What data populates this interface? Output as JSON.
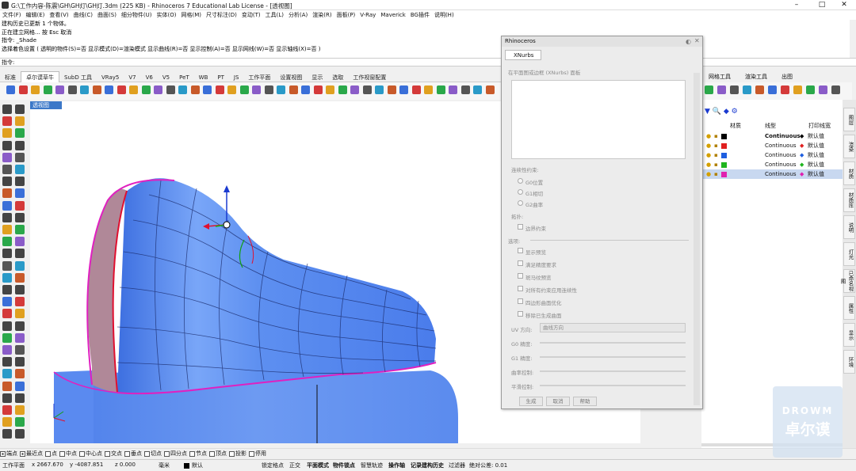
{
  "title_bar": {
    "text": "G:\\工作内容-陈震\\GH\\GH灯\\GH灯.3dm (225 KB) - Rhinoceros 7 Educational Lab License - [透视图]"
  },
  "menu": [
    "文件(F)",
    "编辑(E)",
    "查看(V)",
    "曲线(C)",
    "曲面(S)",
    "细分物件(U)",
    "实体(O)",
    "网格(M)",
    "尺寸标注(D)",
    "变动(T)",
    "工具(L)",
    "分析(A)",
    "渲染(R)",
    "面板(P)",
    "V-Ray",
    "Maverick",
    "BG插件",
    "说明(H)"
  ],
  "command_history": [
    "建构历史已更新 1 个物体。",
    "正在建立网格... 按 Esc 取消",
    "指令: _Shade",
    "选择着色设置 ( 透明的物件(S)=否  显示模式(D)=渲染模式  显示曲线(R)=否  显示控制(A)=否  显示网线(W)=否  显示轴线(X)=否 )"
  ],
  "command_prompt": "指令:",
  "toolbar_tabs": [
    "标准",
    "卓尔谟草牛",
    "SubD 工具",
    "VRay5",
    "V7",
    "V6",
    "V5",
    "PeT",
    "WB",
    "PT",
    "JS",
    "工作平面",
    "设置视图",
    "显示",
    "选取",
    "工作视窗配置"
  ],
  "toolbar_tabs_active": 1,
  "toolbar_tabs_right": [
    "网格工具",
    "渲染工具",
    "出图"
  ],
  "viewport": {
    "label": "透视图"
  },
  "xnurbs_panel": {
    "title": "Rhinoceros",
    "tab": "XNurbs",
    "section1": "在平面图或边框 (XNurbs) 面板",
    "section2": "连续性约束:",
    "radio_options": [
      "G0位置",
      "G1相切",
      "G2曲率"
    ],
    "section3": "拓扑:",
    "boundary_opt": "边界约束",
    "section4": "选项:",
    "checkbox_options": [
      "显示预览",
      "满足精度要求",
      "斑马纹预览",
      "对所有约束应用连续性",
      "四边形曲面优化",
      "移除已生成曲面"
    ],
    "uv_label": "UV 方向:",
    "uv_value": "曲线方向",
    "sliders": [
      "G0 精度:",
      "G1 精度:",
      "曲率控制:",
      "平滑控制:"
    ],
    "buttons": [
      "生成",
      "取消",
      "帮助"
    ]
  },
  "layers": {
    "headers": [
      "材质",
      "线型",
      "打印线宽"
    ],
    "rows": [
      {
        "color": "#000000",
        "linetype": "Continuous",
        "print": "默认值",
        "diamond": "#000000",
        "bold": true
      },
      {
        "color": "#e02020",
        "linetype": "Continuous",
        "print": "默认值",
        "diamond": "#e02020",
        "bold": false
      },
      {
        "color": "#1f5fe0",
        "linetype": "Continuous",
        "print": "默认值",
        "diamond": "#1f5fe0",
        "bold": false
      },
      {
        "color": "#1fb51f",
        "linetype": "Continuous",
        "print": "默认值",
        "diamond": "#1fb51f",
        "bold": false
      },
      {
        "color": "#e020b0",
        "linetype": "Continuous",
        "print": "默认值",
        "diamond": "#e020b0",
        "bold": false
      }
    ]
  },
  "right_tabs": [
    "图层",
    "渲染",
    "材质",
    "材质库",
    "说明",
    "灯光",
    "已命名视图",
    "属性",
    "显示",
    "环境"
  ],
  "osnaps": [
    "端点",
    "最近点",
    "点",
    "中点",
    "中心点",
    "交点",
    "垂点",
    "切点",
    "四分点",
    "节点",
    "顶点",
    "投影",
    "停用"
  ],
  "osnaps_checked": [
    true,
    true,
    false,
    false,
    false,
    false,
    false,
    false,
    false,
    false,
    false,
    false,
    false
  ],
  "status": {
    "plane": "工作平面",
    "x": "x 2667.670",
    "y": "y -4087.851",
    "z": "z 0.000",
    "unit": "毫米",
    "layer": "默认",
    "items": [
      "锁定格点",
      "正交",
      "平面模式",
      "物件锁点",
      "智慧轨迹",
      "操作轴",
      "记录建构历史",
      "过滤器",
      "绝对公差: 0.01"
    ]
  },
  "watermark": {
    "line1": "DROWM",
    "line2": "卓尔谟"
  },
  "colors": {
    "surface_blue": "#5a8eef",
    "surface_mauve": "#b08898",
    "edge_magenta": "#e020c0",
    "edge_red": "#e01030"
  }
}
